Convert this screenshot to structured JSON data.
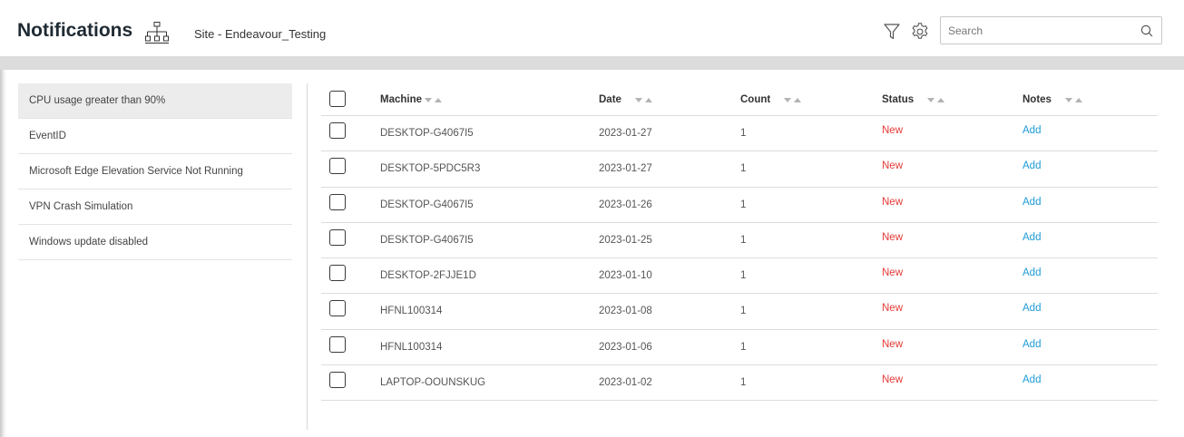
{
  "header": {
    "title": "Notifications",
    "site_label": "Site - Endeavour_Testing",
    "search_placeholder": "Search",
    "search_value": ""
  },
  "icons": {
    "sitemap": "sitemap-icon",
    "filter": "filter-icon",
    "settings": "gear-icon",
    "search": "search-icon",
    "sort": "sort-arrows-icon"
  },
  "colors": {
    "status_new": "#e53935",
    "notes_link": "#1e9bd7",
    "active_item_bg": "#ececec"
  },
  "sidebar": {
    "items": [
      {
        "label": "CPU usage greater than 90%",
        "active": true
      },
      {
        "label": "EventID",
        "active": false
      },
      {
        "label": "Microsoft Edge Elevation Service Not Running",
        "active": false
      },
      {
        "label": "VPN Crash Simulation",
        "active": false
      },
      {
        "label": "Windows update disabled",
        "active": false
      }
    ]
  },
  "table": {
    "columns": [
      "Machine",
      "Date",
      "Count",
      "Status",
      "Notes"
    ],
    "rows": [
      {
        "machine": "DESKTOP-G4067I5",
        "date": "2023-01-27",
        "count": "1",
        "status": "New",
        "notes": "Add"
      },
      {
        "machine": "DESKTOP-5PDC5R3",
        "date": "2023-01-27",
        "count": "1",
        "status": "New",
        "notes": "Add"
      },
      {
        "machine": "DESKTOP-G4067I5",
        "date": "2023-01-26",
        "count": "1",
        "status": "New",
        "notes": "Add"
      },
      {
        "machine": "DESKTOP-G4067I5",
        "date": "2023-01-25",
        "count": "1",
        "status": "New",
        "notes": "Add"
      },
      {
        "machine": "DESKTOP-2FJJE1D",
        "date": "2023-01-10",
        "count": "1",
        "status": "New",
        "notes": "Add"
      },
      {
        "machine": "HFNL100314",
        "date": "2023-01-08",
        "count": "1",
        "status": "New",
        "notes": "Add"
      },
      {
        "machine": "HFNL100314",
        "date": "2023-01-06",
        "count": "1",
        "status": "New",
        "notes": "Add"
      },
      {
        "machine": "LAPTOP-OOUNSKUG",
        "date": "2023-01-02",
        "count": "1",
        "status": "New",
        "notes": "Add"
      }
    ]
  }
}
